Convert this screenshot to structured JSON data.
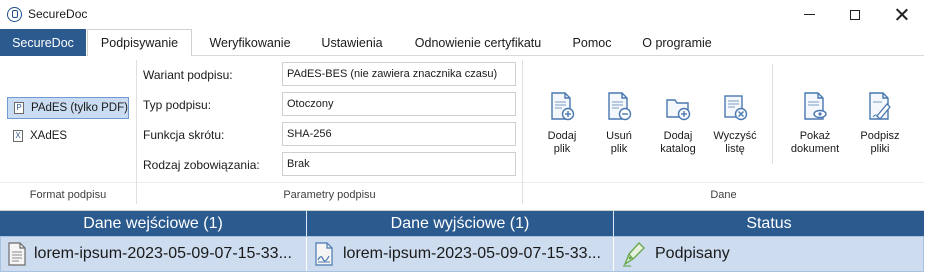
{
  "window": {
    "title": "SecureDoc"
  },
  "tabs": {
    "main": "SecureDoc",
    "items": [
      "Podpisywanie",
      "Weryfikowanie",
      "Ustawienia",
      "Odnowienie certyfikatu",
      "Pomoc",
      "O programie"
    ],
    "active": "Podpisywanie"
  },
  "format_group": {
    "label": "Format podpisu",
    "items": [
      {
        "label": "PAdES (tylko PDF)",
        "icon": "pdf-file-icon",
        "selected": true
      },
      {
        "label": "XAdES",
        "icon": "xml-file-icon",
        "selected": false
      }
    ]
  },
  "params_group": {
    "label": "Parametry podpisu",
    "rows": [
      {
        "label": "Wariant podpisu:",
        "value": "PAdES-BES (nie zawiera znacznika czasu)"
      },
      {
        "label": "Typ podpisu:",
        "value": "Otoczony"
      },
      {
        "label": "Funkcja skrótu:",
        "value": "SHA-256"
      },
      {
        "label": "Rodzaj zobowiązania:",
        "value": "Brak"
      }
    ]
  },
  "data_group": {
    "label": "Dane",
    "buttons": [
      {
        "line1": "Dodaj",
        "line2": "plik",
        "icon": "add-file-icon"
      },
      {
        "line1": "Usuń",
        "line2": "plik",
        "icon": "remove-file-icon"
      },
      {
        "line1": "Dodaj",
        "line2": "katalog",
        "icon": "add-folder-icon"
      },
      {
        "line1": "Wyczyść",
        "line2": "listę",
        "icon": "clear-list-icon"
      },
      {
        "line1": "Pokaż",
        "line2": "dokument",
        "icon": "show-document-icon"
      },
      {
        "line1": "Podpisz",
        "line2": "pliki",
        "icon": "sign-files-icon"
      }
    ]
  },
  "table": {
    "columns": [
      "Dane wejściowe (1)",
      "Dane wyjściowe (1)",
      "Status"
    ],
    "rows": [
      {
        "input": "lorem-ipsum-2023-05-09-07-15-33...",
        "output": "lorem-ipsum-2023-05-09-07-15-33...",
        "status": "Podpisany"
      }
    ]
  },
  "colors": {
    "accent": "#2b5a8e",
    "row_selected": "#cddcef",
    "icon_blue": "#4a78b0"
  }
}
